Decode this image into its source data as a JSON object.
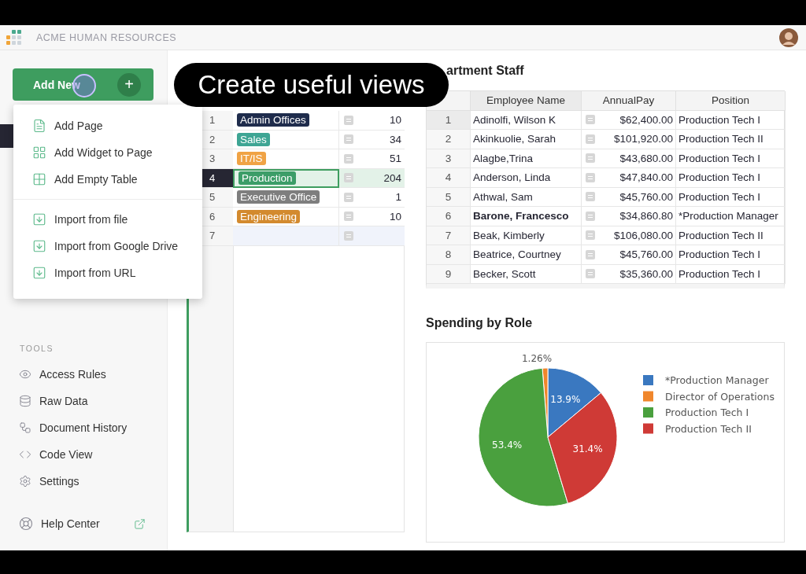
{
  "header": {
    "title": "ACME HUMAN RESOURCES"
  },
  "add_new": {
    "label": "Add New",
    "plus": "+"
  },
  "menu": {
    "items": [
      {
        "label": "Add Page",
        "kind": "page"
      },
      {
        "label": "Add Widget to Page",
        "kind": "widget"
      },
      {
        "label": "Add Empty Table",
        "kind": "table"
      },
      {
        "label": "Import from file",
        "kind": "import"
      },
      {
        "label": "Import from Google Drive",
        "kind": "import"
      },
      {
        "label": "Import from URL",
        "kind": "import"
      }
    ]
  },
  "caption": "Create useful views",
  "tools": {
    "heading": "TOOLS",
    "items": [
      {
        "label": "Access Rules",
        "kind": "eye"
      },
      {
        "label": "Raw Data",
        "kind": "database"
      },
      {
        "label": "Document History",
        "kind": "history"
      },
      {
        "label": "Code View",
        "kind": "code"
      },
      {
        "label": "Settings",
        "kind": "settings"
      }
    ],
    "help": "Help Center"
  },
  "departments": {
    "rows": [
      {
        "num": "1",
        "name": "Admin Offices",
        "color": "#1f2c4c",
        "count": "10",
        "selected": false,
        "kind": "row"
      },
      {
        "num": "2",
        "name": "Sales",
        "color": "#3ea594",
        "count": "34",
        "selected": false,
        "kind": "row"
      },
      {
        "num": "3",
        "name": "IT/IS",
        "color": "#f0a345",
        "count": "51",
        "selected": false,
        "kind": "row"
      },
      {
        "num": "4",
        "name": "Production",
        "color": "#3c9d68",
        "count": "204",
        "selected": true,
        "kind": "row"
      },
      {
        "num": "5",
        "name": "Executive Office",
        "color": "#7e7e7e",
        "count": "1",
        "selected": false,
        "kind": "row"
      },
      {
        "num": "6",
        "name": "Engineering",
        "color": "#d38a2e",
        "count": "10",
        "selected": false,
        "kind": "row"
      },
      {
        "num": "7",
        "selected": false,
        "kind": "new"
      }
    ]
  },
  "staff": {
    "title": "artment Staff",
    "columns": [
      "Employee Name",
      "AnnualPay",
      "Position"
    ],
    "rows": [
      {
        "num": "1",
        "name": "Adinolfi, Wilson  K",
        "pay": "$62,400.00",
        "position": "Production Tech I",
        "bold": false,
        "selected": true
      },
      {
        "num": "2",
        "name": "Akinkuolie, Sarah",
        "pay": "$101,920.00",
        "position": "Production Tech II",
        "bold": false,
        "selected": false
      },
      {
        "num": "3",
        "name": "Alagbe,Trina",
        "pay": "$43,680.00",
        "position": "Production Tech I",
        "bold": false,
        "selected": false
      },
      {
        "num": "4",
        "name": "Anderson, Linda",
        "pay": "$47,840.00",
        "position": "Production Tech I",
        "bold": false,
        "selected": false
      },
      {
        "num": "5",
        "name": "Athwal, Sam",
        "pay": "$45,760.00",
        "position": "Production Tech I",
        "bold": false,
        "selected": false
      },
      {
        "num": "6",
        "name": "Barone, Francesco",
        "pay": "$34,860.80",
        "position": "*Production Manager",
        "bold": true,
        "selected": false
      },
      {
        "num": "7",
        "name": "Beak, Kimberly",
        "pay": "$106,080.00",
        "position": "Production Tech II",
        "bold": false,
        "selected": false
      },
      {
        "num": "8",
        "name": "Beatrice, Courtney",
        "pay": "$45,760.00",
        "position": "Production Tech I",
        "bold": false,
        "selected": false
      },
      {
        "num": "9",
        "name": "Becker, Scott",
        "pay": "$35,360.00",
        "position": "Production Tech I",
        "bold": false,
        "selected": false
      }
    ]
  },
  "spending": {
    "title": "Spending by Role",
    "chart_data": {
      "type": "pie",
      "categories": [
        "*Production Manager",
        "Director of Operations",
        "Production Tech I",
        "Production Tech II"
      ],
      "series": [
        {
          "values": [
            13.9,
            1.26,
            53.4,
            31.4
          ]
        }
      ],
      "legend": "right",
      "colors": [
        "#3a78c0",
        "#f0862c",
        "#4aa03e",
        "#cf3a36"
      ],
      "value_labels": [
        "13.9%",
        "1.26%",
        "53.4%",
        "31.4%"
      ]
    }
  }
}
